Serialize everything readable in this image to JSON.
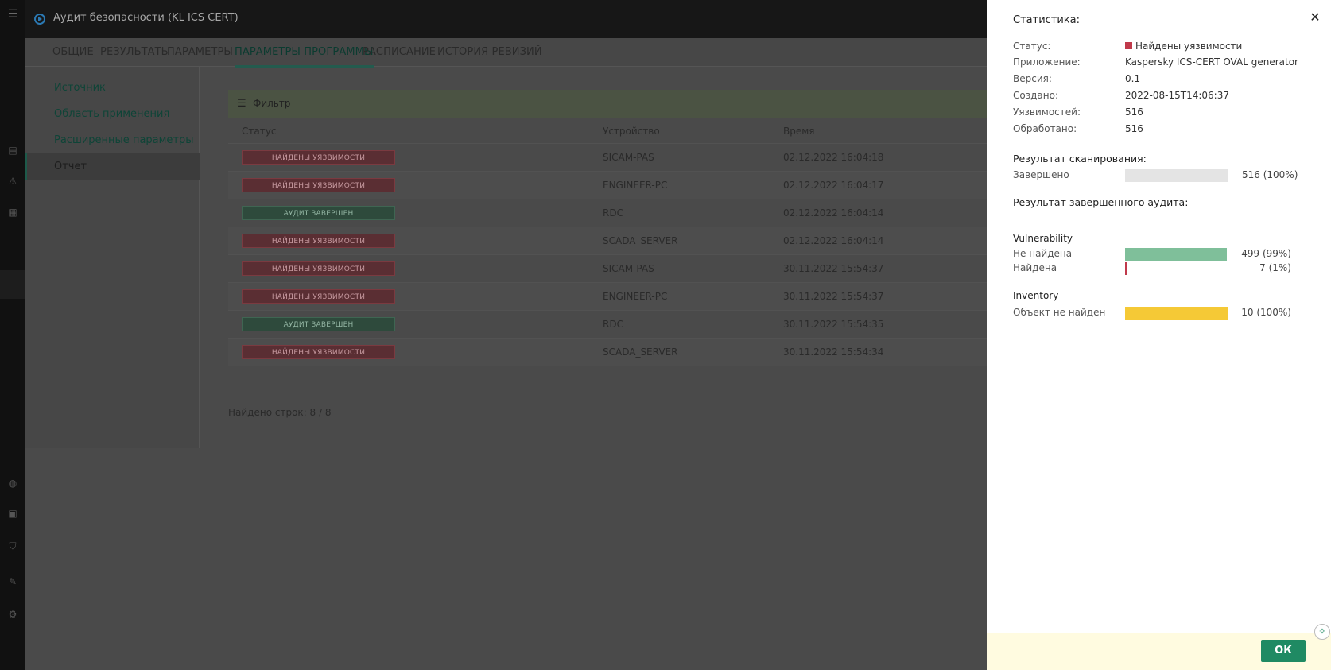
{
  "app": {
    "title": "Аудит безопасности (KL ICS CERT)",
    "tabs": [
      "ОБЩИЕ",
      "РЕЗУЛЬТАТЫ",
      "ПАРАМЕТРЫ",
      "ПАРАМЕТРЫ ПРОГРАММЫ",
      "РАСПИСАНИЕ",
      "ИСТОРИЯ РЕВИЗИЙ"
    ],
    "active_tab": "ПАРАМЕТРЫ ПРОГРАММЫ",
    "sidenav": [
      "Источник",
      "Область применения",
      "Расширенные параметры",
      "Отчет"
    ],
    "active_sidenav": "Отчет",
    "filter_label": "Фильтр",
    "columns": [
      "Статус",
      "Устройство",
      "Время"
    ],
    "rows": [
      {
        "status": "НАЙДЕНЫ УЯЗВИМОСТИ",
        "kind": "found",
        "device": "SICAM-PAS",
        "time": "02.12.2022 16:04:18"
      },
      {
        "status": "НАЙДЕНЫ УЯЗВИМОСТИ",
        "kind": "found",
        "device": "ENGINEER-PC",
        "time": "02.12.2022 16:04:17"
      },
      {
        "status": "АУДИТ ЗАВЕРШЕН",
        "kind": "done",
        "device": "RDC",
        "time": "02.12.2022 16:04:14"
      },
      {
        "status": "НАЙДЕНЫ УЯЗВИМОСТИ",
        "kind": "found",
        "device": "SCADA_SERVER",
        "time": "02.12.2022 16:04:14"
      },
      {
        "status": "НАЙДЕНЫ УЯЗВИМОСТИ",
        "kind": "found",
        "device": "SICAM-PAS",
        "time": "30.11.2022 15:54:37"
      },
      {
        "status": "НАЙДЕНЫ УЯЗВИМОСТИ",
        "kind": "found",
        "device": "ENGINEER-PC",
        "time": "30.11.2022 15:54:37"
      },
      {
        "status": "АУДИТ ЗАВЕРШЕН",
        "kind": "done",
        "device": "RDC",
        "time": "30.11.2022 15:54:35"
      },
      {
        "status": "НАЙДЕНЫ УЯЗВИМОСТИ",
        "kind": "found",
        "device": "SCADA_SERVER",
        "time": "30.11.2022 15:54:34"
      }
    ],
    "row_count": "Найдено строк: 8 / 8"
  },
  "panel": {
    "title": "Статистика:",
    "stats": [
      {
        "key": "Статус:",
        "value": "Найдены уязвимости"
      },
      {
        "key": "Приложение:",
        "value": "Kaspersky ICS-CERT OVAL generator"
      },
      {
        "key": "Версия:",
        "value": "0.1"
      },
      {
        "key": "Создано:",
        "value": "2022-08-15T14:06:37"
      },
      {
        "key": "Уязвимостей:",
        "value": "516"
      },
      {
        "key": "Обработано:",
        "value": "516"
      }
    ],
    "scan_title": "Результат сканирования:",
    "scan": {
      "label": "Завершено",
      "fraction": 1.0,
      "value": "516 (100%)",
      "color": "#e4e4e4"
    },
    "audit_title": "Результат завершенного аудита:",
    "vuln_title": "Vulnerability",
    "vuln": [
      {
        "label": "Не найдена",
        "fraction": 0.99,
        "value": "499 (99%)",
        "color": "#7fbf9a"
      },
      {
        "label": "Найдена",
        "fraction": 0.01,
        "value": "7 (1%)",
        "color": "#c0394b"
      }
    ],
    "inventory_title": "Inventory",
    "inventory": [
      {
        "label": "Объект не найден",
        "fraction": 1.0,
        "value": "10 (100%)",
        "color": "#f5c936"
      }
    ],
    "ok_label": "ОК",
    "close_icon": "close-icon",
    "help_icon": "help-icon"
  }
}
